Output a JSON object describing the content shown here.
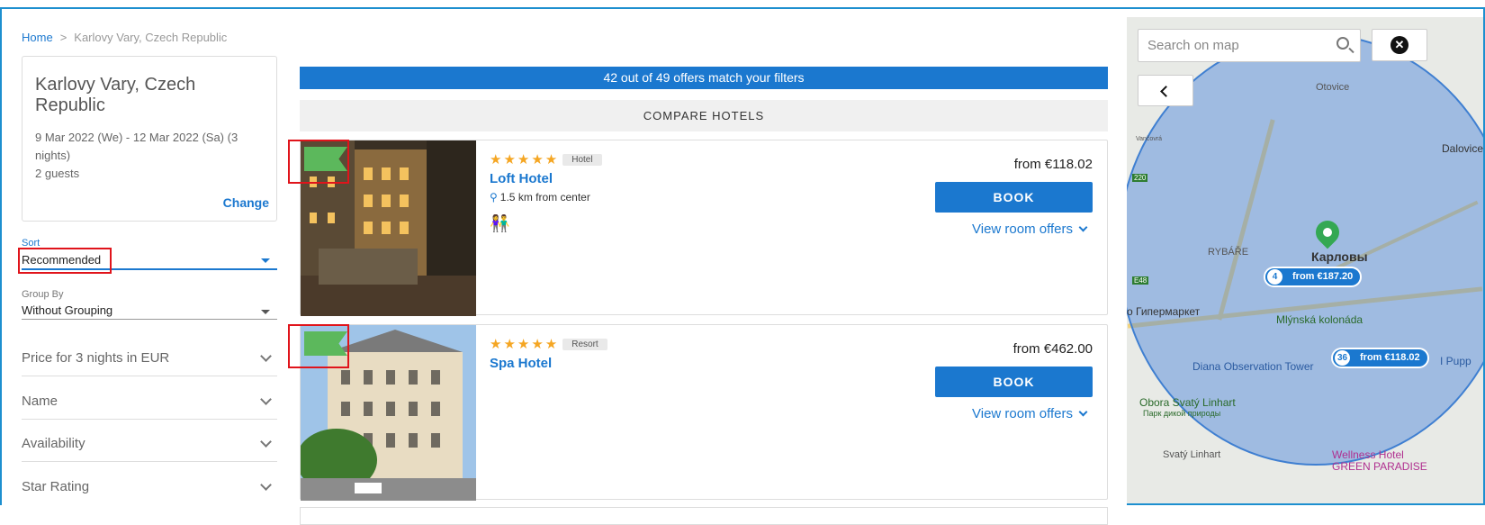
{
  "breadcrumb": {
    "home": "Home",
    "separator": ">",
    "current": "Karlovy Vary, Czech Republic"
  },
  "search_summary": {
    "city": "Karlovy Vary, Czech Republic",
    "dates": "9 Mar 2022 (We) - 12 Mar 2022 (Sa) (3 nights)",
    "guests": "2 guests",
    "change_label": "Change"
  },
  "sort": {
    "label": "Sort",
    "value": "Recommended"
  },
  "group_by": {
    "label": "Group By",
    "value": "Without Grouping"
  },
  "facets": [
    {
      "label": "Price for 3 nights in EUR"
    },
    {
      "label": "Name"
    },
    {
      "label": "Availability"
    },
    {
      "label": "Star Rating"
    }
  ],
  "results_banner": "42 out of 49 offers match your filters",
  "compare_label": "COMPARE HOTELS",
  "hotels": [
    {
      "stars": "★★★★★",
      "type": "Hotel",
      "name": "Loft Hotel",
      "distance": "1.5 km from center",
      "price": "from €118.02",
      "book_label": "BOOK",
      "offers_label": "View room offers"
    },
    {
      "stars": "★★★★★",
      "type": "Resort",
      "name": "Spa Hotel",
      "price": "from €462.00",
      "book_label": "BOOK",
      "offers_label": "View room offers"
    }
  ],
  "map": {
    "search_placeholder": "Search on map",
    "labels": [
      "Otovice",
      "Dalovice",
      "RYBÁŘE",
      "Карловы Вары",
      "о Гипермаркет",
      "Mlýnská kolonáda",
      "Diana Observation Tower",
      "I Pupp",
      "Obora Svatý Linhart",
      "Парк дикой природы",
      "Svatý Linhart",
      "Wellness Hotel GREEN PARADISE",
      "Vančovrá",
      "220",
      "E48"
    ],
    "price_tags": [
      {
        "count": "4",
        "label": "from €187.20"
      },
      {
        "count": "36",
        "label": "from €118.02"
      }
    ]
  },
  "colors": {
    "accent": "#1b78cf",
    "highlight": "#e0141b",
    "flag": "#5cb85c",
    "stars": "#f5a623"
  }
}
